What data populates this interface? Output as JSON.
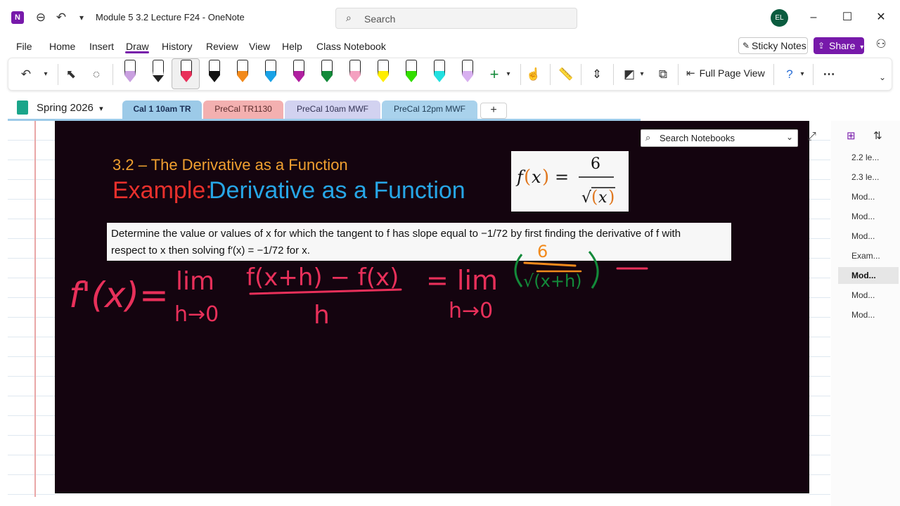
{
  "titlebar": {
    "app_icon": "N",
    "back_icon": "back-arrow-icon",
    "undo_icon": "undo-icon",
    "qat_icon": "customize-dropdown-icon",
    "title": "Module 5 3.2 Lecture F24  -  OneNote",
    "search_placeholder": "Search",
    "avatar_initials": "EL",
    "minimize": "–",
    "maximize": "☐",
    "close": "✕"
  },
  "menu": {
    "items": [
      "File",
      "Home",
      "Insert",
      "Draw",
      "History",
      "Review",
      "View",
      "Help",
      "Class Notebook"
    ],
    "active": "Draw",
    "sticky_notes": "Sticky Notes",
    "share": "Share"
  },
  "ribbon": {
    "full_page_view": "Full Page View",
    "pen_colors": [
      "#c9a0e0",
      "#ffffff",
      "#e8305a",
      "#111111",
      "#f28a1c",
      "#1aa2e6",
      "#b020a0",
      "#138a3a",
      "#f4a0c0",
      "#ffee00",
      "#33dd00",
      "#22e0e0",
      "#d8b0f0"
    ],
    "accent": "#7719aa"
  },
  "notebook": {
    "name": "Spring 2026",
    "tabs": [
      {
        "label": "Cal 1 10am TR",
        "bg": "#9ccae8",
        "color": "#1a2f55",
        "active": true
      },
      {
        "label": "PreCal TR1130",
        "bg": "#f3b0b0",
        "color": "#5a2b2b",
        "active": false
      },
      {
        "label": "PreCal 10am MWF",
        "bg": "#d2d2f0",
        "color": "#333355",
        "active": false
      },
      {
        "label": "PreCal 12pm MWF",
        "bg": "#a9d2ec",
        "color": "#1f3c55",
        "active": false
      }
    ],
    "add_tab": "+"
  },
  "slide": {
    "subtitle": "3.2 – The Derivative as a Function",
    "example": "Example:",
    "title": "Derivative as a Function",
    "formula_lhs": "f(x) =",
    "formula_num": "6",
    "formula_den": "√x",
    "problem_line1": "Determine the value or values of x for which the tangent to f has slope equal to −1/72 by first finding the derivative of f with",
    "problem_line2": "respect to x then solving f′(x) = −1/72 for x."
  },
  "handwriting": {
    "f_prime": "f'(x)=",
    "lim1": "lim",
    "h_to_0_1": "h→0",
    "numerator": "f(x+h) − f(x)",
    "denominator": "h",
    "eq_lim2": "= lim",
    "h_to_0_2": "h→0",
    "six": "6",
    "sqrt_xh": "√(x+h)",
    "ink_colors": {
      "red": "#e8305a",
      "green": "#138a3a",
      "orange": "#f28a1c"
    }
  },
  "overlay": {
    "search_notebooks": "Search Notebooks"
  },
  "pages": {
    "items": [
      "2.2 le...",
      "2.3 le...",
      "Mod...",
      "Mod...",
      "Mod...",
      "Exam...",
      "Mod...",
      "Mod...",
      "Mod..."
    ],
    "active_index": 6
  }
}
